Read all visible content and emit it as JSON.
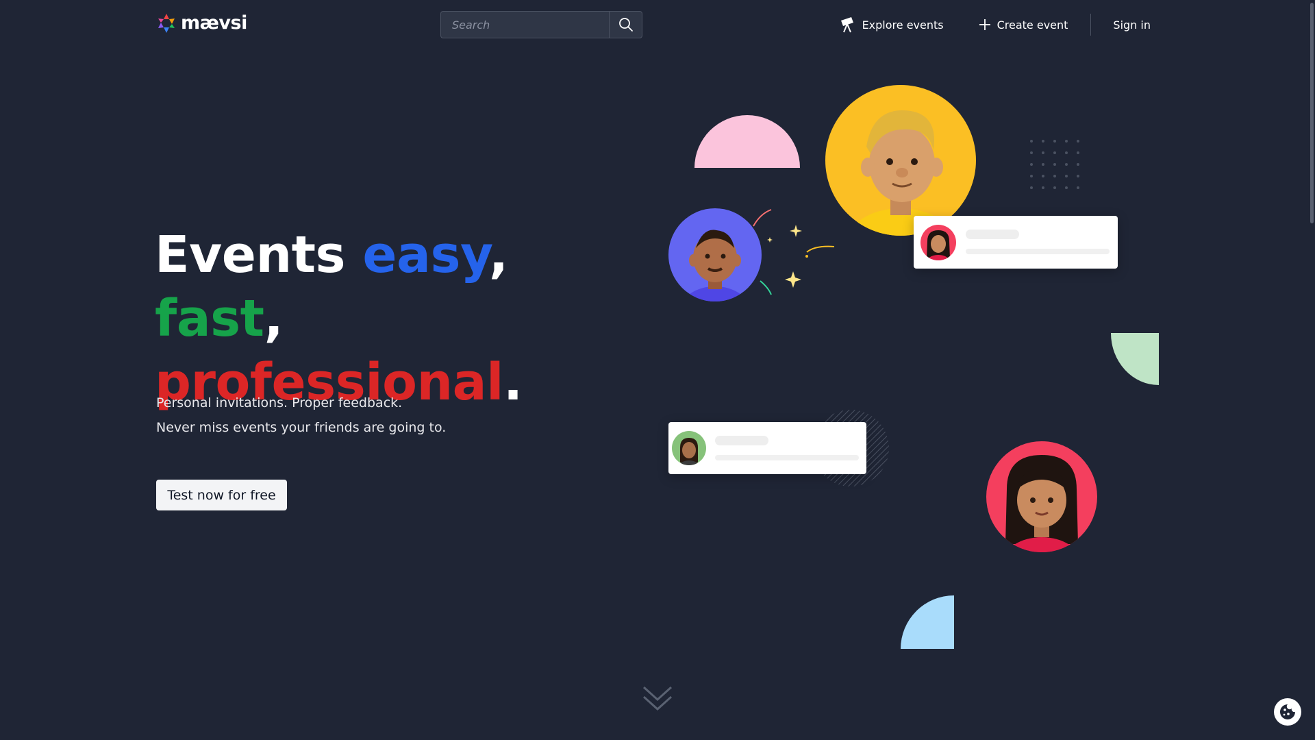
{
  "brand": {
    "name": "mævsi"
  },
  "search": {
    "placeholder": "Search"
  },
  "nav": {
    "explore_label": "Explore events",
    "create_label": "Create event",
    "signin_label": "Sign in"
  },
  "hero": {
    "word_events": "Events",
    "word_easy": "easy",
    "comma1": ",",
    "word_fast": "fast",
    "comma2": ",",
    "word_professional": "professional",
    "period": ".",
    "subtext_line1": "Personal invitations. Proper feedback.",
    "subtext_line2": "Never miss events your friends are going to.",
    "cta_label": "Test now for free"
  },
  "colors": {
    "background": "#1f2535",
    "easy": "#2563eb",
    "fast": "#16a34a",
    "professional": "#dc2626",
    "pink_shape": "#fbc4dc",
    "green_shape": "#bfe4c6",
    "blue_shape": "#a9dcfb",
    "avatar_yellow": "#fbbf24",
    "avatar_purple": "#6366f1",
    "avatar_red": "#f43f5e"
  },
  "icons": {
    "logo": "maevsi-star-logo-icon",
    "search": "search-icon",
    "explore": "telescope-icon",
    "create": "plus-icon",
    "scroll": "double-chevron-down-icon",
    "cookie": "cookie-icon"
  }
}
